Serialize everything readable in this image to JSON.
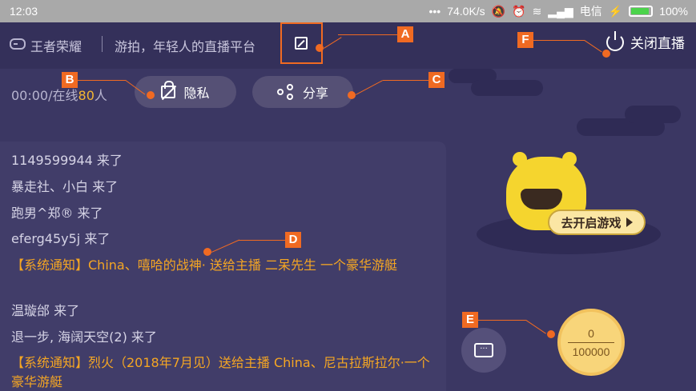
{
  "status_bar": {
    "time": "12:03",
    "network_speed": "74.0K/s",
    "carrier": "电信",
    "battery": "100%",
    "icons": [
      "alarm-icon",
      "wifi-icon",
      "signal-icon",
      "charging-icon"
    ]
  },
  "top_bar": {
    "game_name": "王者荣耀",
    "subtitle": "游拍，年轻人的直播平台",
    "close_label": "关闭直播"
  },
  "stats": {
    "prefix": "00:00/在线",
    "count": "80",
    "suffix": "人"
  },
  "buttons": {
    "privacy": "隐私",
    "share": "分享",
    "play_game": "去开启游戏"
  },
  "chat": {
    "lines": [
      {
        "text": "1149599944 来了",
        "type": "normal"
      },
      {
        "text": "暴走社、小白 来了",
        "type": "normal"
      },
      {
        "text": "跑男^郑® 来了",
        "type": "normal"
      },
      {
        "text": "eferg45y5j 来了",
        "type": "normal"
      },
      {
        "text": "【系统通知】China、嘻哈的战神· 送给主播 二呆先生 一个豪华游艇",
        "type": "notice"
      },
      {
        "text": "温璇邰 来了",
        "type": "normal"
      },
      {
        "text": "退一步, 海阔天空(2) 来了",
        "type": "normal"
      },
      {
        "text": "【系统通知】烈火（2018年7月见）送给主播 China、尼古拉斯拉尔·一个豪华游艇",
        "type": "notice"
      }
    ]
  },
  "coin": {
    "current": "0",
    "target": "100000"
  },
  "annotations": [
    "A",
    "B",
    "C",
    "D",
    "E",
    "F"
  ],
  "colors": {
    "background": "#3b3763",
    "accent": "#f06a22",
    "notice": "#f5a623",
    "online_count": "#f5b731"
  }
}
